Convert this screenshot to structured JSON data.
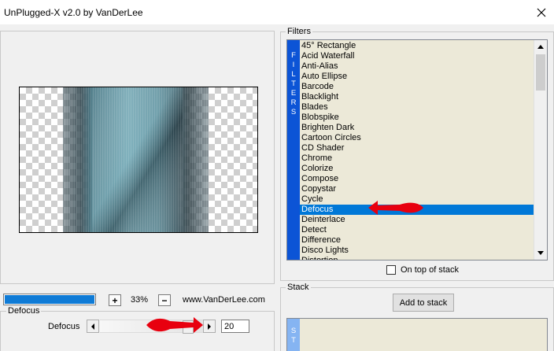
{
  "window": {
    "title": "UnPlugged-X v2.0 by VanDerLee",
    "close_glyph": "✕"
  },
  "zoom": {
    "plus_label": "+",
    "minus_label": "−",
    "level": "33%",
    "progress_fraction": 1.0
  },
  "website": "www.VanDerLee.com",
  "defocus_group": {
    "label": "Defocus",
    "param_label": "Defocus",
    "value": "20",
    "slider_fraction": 0.9
  },
  "filters_group": {
    "label": "Filters",
    "strip_letters": [
      "F",
      "I",
      "L",
      "T",
      "E",
      "R",
      "S"
    ],
    "items": [
      "45° Rectangle",
      "Acid Waterfall",
      "Anti-Alias",
      "Auto Ellipse",
      "Barcode",
      "Blacklight",
      "Blades",
      "Blobspike",
      "Brighten Dark",
      "Cartoon Circles",
      "CD Shader",
      "Chrome",
      "Colorize",
      "Compose",
      "Copystar",
      "Cycle",
      "Defocus",
      "Deinterlace",
      "Detect",
      "Difference",
      "Disco Lights",
      "Distortion"
    ],
    "selected_index": 16,
    "on_top_label": "On top of stack",
    "on_top_checked": false
  },
  "stack_group": {
    "label": "Stack",
    "add_button_label": "Add to stack",
    "strip_letters": [
      "S",
      "T"
    ]
  },
  "colors": {
    "selection": "#0078d7",
    "filters_strip": "#0c54d6",
    "stack_strip": "#85b4f2",
    "list_background": "#ece9d8",
    "annotation_arrow": "#e8000f",
    "progress_fill": "#0f7bd6"
  },
  "icons": {
    "close": "close-icon",
    "scroll_up": "scroll-up-icon",
    "scroll_down": "scroll-down-icon",
    "slider_left": "chevron-left-icon",
    "slider_right": "chevron-right-icon"
  }
}
